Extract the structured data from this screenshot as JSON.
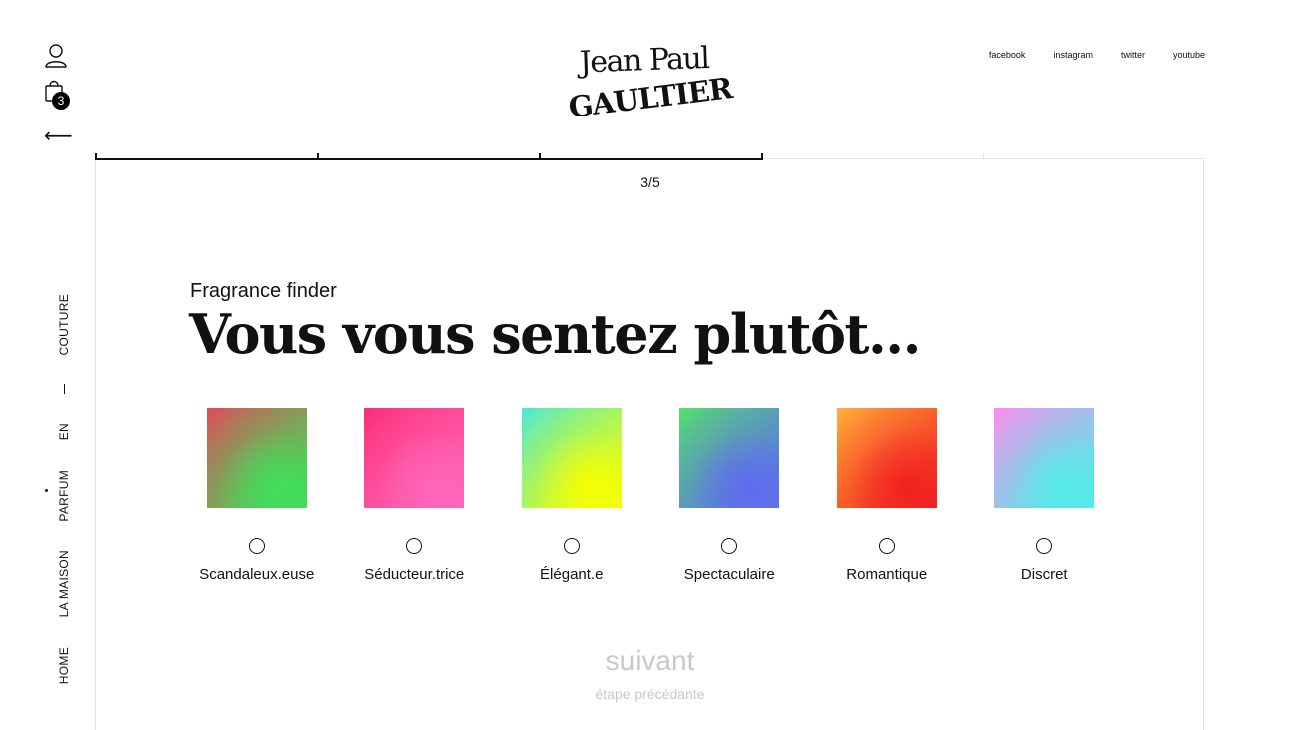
{
  "header": {
    "logo_line1": "Jean Paul",
    "logo_line2": "GAULTIER",
    "cart_count": "3",
    "back_arrow": "⟵",
    "social": [
      {
        "label": "facebook"
      },
      {
        "label": "instagram"
      },
      {
        "label": "twitter"
      },
      {
        "label": "youtube"
      }
    ]
  },
  "sidebar": {
    "nav": [
      {
        "label": "HOME"
      },
      {
        "label": "LA MAISON"
      },
      {
        "label": "PARFUM"
      },
      {
        "label": "EN"
      },
      {
        "label": "COUTURE"
      }
    ]
  },
  "progress": {
    "current": 3,
    "total": 5,
    "label": "3/5"
  },
  "quiz": {
    "eyebrow": "Fragrance finder",
    "question": "Vous vous sentez plutôt...",
    "options": [
      {
        "label": "Scandaleux.euse",
        "icon": "gradient-swatch-red-green",
        "colors": [
          "#e04a5a",
          "#3ee05a"
        ]
      },
      {
        "label": "Séducteur.trice",
        "icon": "gradient-swatch-pink",
        "colors": [
          "#ff2d78",
          "#ff66b8"
        ]
      },
      {
        "label": "Élégant.e",
        "icon": "gradient-swatch-yellow",
        "colors": [
          "#49e8d6",
          "#f6ff00"
        ]
      },
      {
        "label": "Spectaculaire",
        "icon": "gradient-swatch-blue",
        "colors": [
          "#54e06a",
          "#5e6bf0"
        ]
      },
      {
        "label": "Romantique",
        "icon": "gradient-swatch-red-orange",
        "colors": [
          "#ffb23a",
          "#f22020"
        ]
      },
      {
        "label": "Discret",
        "icon": "gradient-swatch-cyan",
        "colors": [
          "#ff8cf0",
          "#52ece6"
        ]
      }
    ],
    "next_label": "suivant",
    "prev_label": "étape précédante"
  },
  "colors": {
    "text": "#111111",
    "disabled": "#c8c8c8",
    "frame": "#e2e2e2"
  }
}
